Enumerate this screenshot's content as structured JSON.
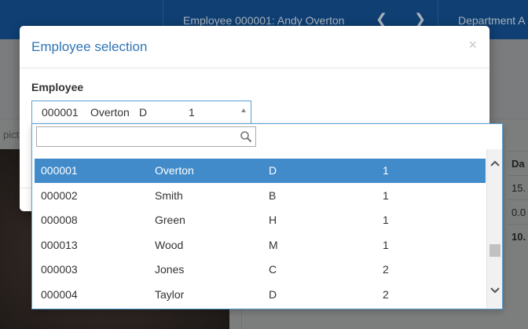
{
  "header": {
    "employee_title": "Employee 000001: Andy Overton",
    "dept_title": "Department A",
    "prev_icon": "chevron-left-icon",
    "next_icon": "chevron-right-icon"
  },
  "background": {
    "pic_label": "pict",
    "table_header": "Da",
    "table_values": [
      "15.",
      "0.0",
      "10."
    ]
  },
  "modal": {
    "title": "Employee selection",
    "close_glyph": "×",
    "field_label": "Employee"
  },
  "select": {
    "id": "000001",
    "name": "Overton",
    "code": "D",
    "level": "1"
  },
  "search": {
    "placeholder": "",
    "value": ""
  },
  "colors": {
    "accent": "#2f76b4",
    "selected_row": "#428bca",
    "header_bg": "#0f3f73"
  },
  "employees": [
    {
      "id": "000001",
      "name": "Overton",
      "code": "D",
      "level": "1"
    },
    {
      "id": "000002",
      "name": "Smith",
      "code": "B",
      "level": "1"
    },
    {
      "id": "000008",
      "name": "Green",
      "code": "H",
      "level": "1"
    },
    {
      "id": "000013",
      "name": "Wood",
      "code": "M",
      "level": "1"
    },
    {
      "id": "000003",
      "name": "Jones",
      "code": "C",
      "level": "2"
    },
    {
      "id": "000004",
      "name": "Taylor",
      "code": "D",
      "level": "2"
    }
  ]
}
